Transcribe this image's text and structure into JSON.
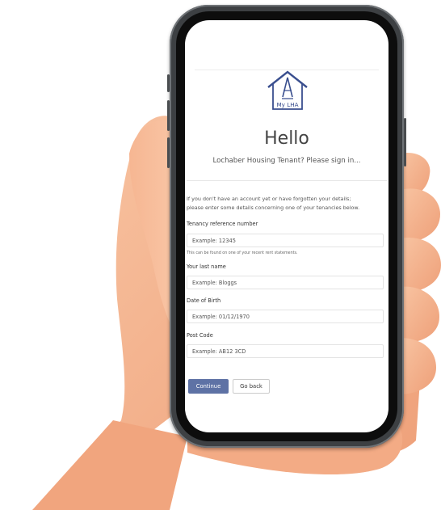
{
  "app": {
    "logo_text": "My LHA",
    "heading": "Hello",
    "subtitle": "Lochaber Housing Tenant? Please sign in...",
    "intro_line1": "If you don't have an account yet or have forgotten your details;",
    "intro_line2": "please enter some details concerning one of your tenancies below."
  },
  "form": {
    "tenancy": {
      "label": "Tenancy reference number",
      "placeholder": "Example: 12345",
      "hint": "This can be found on one of your recent rent statements."
    },
    "last_name": {
      "label": "Your last name",
      "placeholder": "Example: Bloggs"
    },
    "dob": {
      "label": "Date of Birth",
      "placeholder": "Example: 01/12/1970"
    },
    "postcode": {
      "label": "Post Code",
      "placeholder": "Example: AB12 3CD"
    }
  },
  "buttons": {
    "continue": "Continue",
    "back": "Go back"
  },
  "colors": {
    "primary": "#5e72a5",
    "logo": "#3a4f8f",
    "skin": "#f4b08a"
  }
}
